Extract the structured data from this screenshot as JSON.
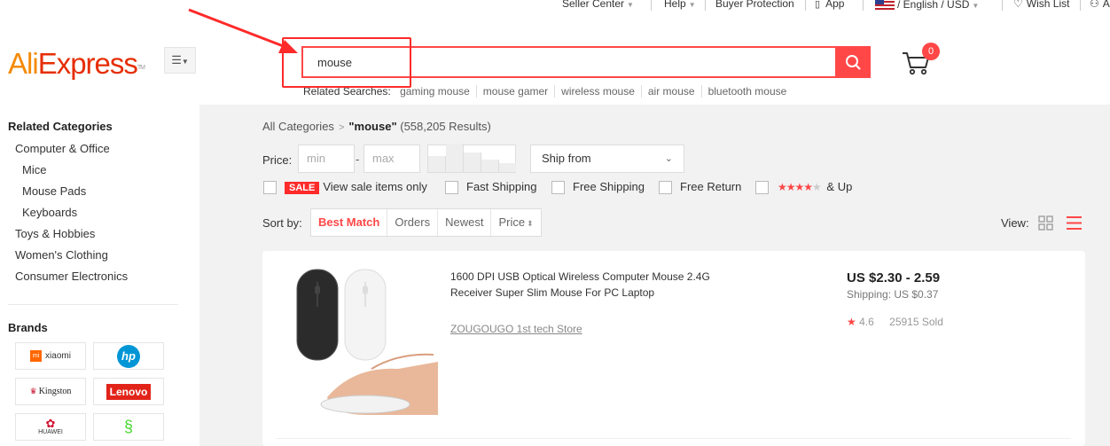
{
  "topbar": {
    "seller_center": "Seller Center",
    "help": "Help",
    "buyer_protection": "Buyer Protection",
    "app": "App",
    "language": "/ English / USD",
    "wish_list": "Wish List",
    "account": "A"
  },
  "header": {
    "logo_ali": "Ali",
    "logo_express": "Express",
    "logo_tm": "TM"
  },
  "search": {
    "value": "mouse",
    "related_label": "Related Searches:",
    "related": [
      "gaming mouse",
      "mouse gamer",
      "wireless mouse",
      "air mouse",
      "bluetooth mouse"
    ]
  },
  "cart": {
    "count": "0"
  },
  "sidebar": {
    "categories_title": "Related Categories",
    "categories": [
      {
        "label": "Computer & Office",
        "level": 1
      },
      {
        "label": "Mice",
        "level": 2
      },
      {
        "label": "Mouse Pads",
        "level": 2
      },
      {
        "label": "Keyboards",
        "level": 2
      },
      {
        "label": "Toys & Hobbies",
        "level": 1
      },
      {
        "label": "Women's Clothing",
        "level": 1
      },
      {
        "label": "Consumer Electronics",
        "level": 1
      }
    ],
    "brands_title": "Brands",
    "brands": [
      "xiaomi",
      "hp",
      "Kingston",
      "Lenovo",
      "HUAWEI",
      "Razer"
    ]
  },
  "breadcrumb": {
    "root": "All Categories",
    "query": "\"mouse\"",
    "results": "(558,205 Results)"
  },
  "filters": {
    "price_label": "Price:",
    "min_placeholder": "min",
    "max_placeholder": "max",
    "dash": "-",
    "ship_from": "Ship from",
    "sale_badge": "SALE",
    "sale_label": "View sale items only",
    "fast_shipping": "Fast Shipping",
    "free_shipping": "Free Shipping",
    "free_return": "Free Return",
    "rating_suffix": "& Up",
    "rating_stars_filled": 4
  },
  "sort": {
    "label": "Sort by:",
    "options": [
      "Best Match",
      "Orders",
      "Newest",
      "Price"
    ],
    "active": "Best Match",
    "view_label": "View:"
  },
  "product": {
    "title": "1600 DPI USB Optical Wireless Computer Mouse 2.4G Receiver Super Slim Mouse For PC Laptop",
    "store": "ZOUGOUGO 1st tech Store",
    "price": "US $2.30 - 2.59",
    "shipping": "Shipping: US $0.37",
    "rating": "4.6",
    "sold": "25915 Sold"
  },
  "colors": {
    "accent": "#ff4747",
    "logo_orange": "#f58a07",
    "logo_red": "#e62e04"
  }
}
